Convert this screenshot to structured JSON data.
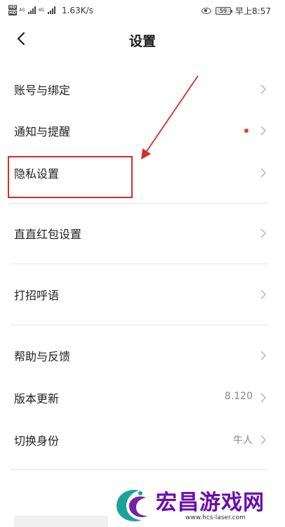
{
  "status_bar": {
    "hd_tags": [
      "HD",
      "HD"
    ],
    "net_labels": [
      "4G",
      "4G"
    ],
    "net_speed": "1.63K/s",
    "battery": "59",
    "time": "早上8:57"
  },
  "header": {
    "title": "设置"
  },
  "menu": {
    "items": [
      {
        "label": "账号与绑定",
        "value": ""
      },
      {
        "label": "通知与提醒",
        "value": "",
        "badge": "red-dot"
      },
      {
        "label": "隐私设置",
        "value": ""
      },
      {
        "label": "直直红包设置",
        "value": ""
      },
      {
        "label": "打招呼语",
        "value": ""
      },
      {
        "label": "帮助与反馈",
        "value": ""
      },
      {
        "label": "版本更新",
        "value": "8.120"
      },
      {
        "label": "切换身份",
        "value": "牛人"
      }
    ]
  },
  "annotation": {
    "color": "#d32f2f",
    "highlighted_item": "隐私设置"
  },
  "watermark": {
    "text": "宏昌游戏网",
    "url": "www.hcs-laser.com"
  },
  "colors": {
    "accent_red": "#e53935",
    "watermark_purple": "#6a0dad",
    "watermark_teal": "#1aa39a"
  }
}
